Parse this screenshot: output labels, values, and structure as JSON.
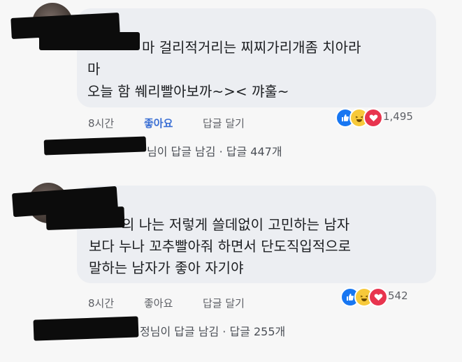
{
  "comments": [
    {
      "lines": [
        "마 걸리적거리는 찌찌가리개좀 치아라",
        "마",
        "오늘 함 쒜리빨아보까~>< 꺄훌~"
      ],
      "time": "8시간",
      "like_label": "좋아요",
      "reply_label": "답글 달기",
      "reaction_count": "1,495",
      "reactions": [
        "like-icon",
        "haha-icon",
        "love-icon"
      ],
      "reply_summary": "님이 답글 남김 · 답글 447개"
    },
    {
      "lines": [
        "의 나는 저렇게 쓸데없이 고민하는 남자",
        "보다 누나 꼬추빨아줘 하면서 단도직입적으로",
        "말하는 남자가 좋아 자기야"
      ],
      "time": "8시간",
      "like_label": "좋아요",
      "reply_label": "답글 달기",
      "reaction_count": "542",
      "reactions": [
        "like-icon",
        "haha-icon",
        "love-icon"
      ],
      "reply_summary": "정님이 답글 남김 · 답글 255개"
    }
  ],
  "colors": {
    "bubble": "#eceef2",
    "like_active": "#3b6fd4",
    "like_reaction": "#1877f2",
    "haha_reaction": "#f7c93a",
    "love_reaction": "#e8344e"
  }
}
